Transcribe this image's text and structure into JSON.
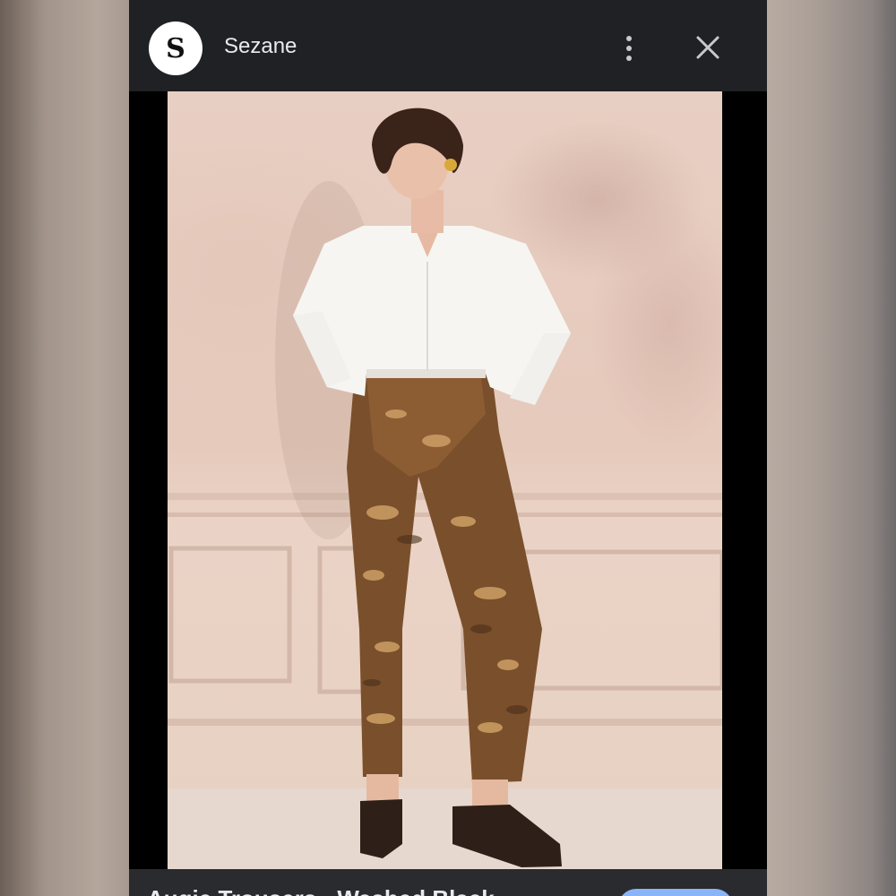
{
  "header": {
    "site_initial": "S",
    "site_name": "Sezane",
    "more_icon": "more-vert-icon",
    "close_icon": "close-icon"
  },
  "image": {
    "description_icon": "lens-search-icon"
  },
  "footer": {
    "partial_title": "Augie Trousers - Washed Black"
  },
  "colors": {
    "header_bg": "#202124",
    "accent": "#8ab4f8"
  }
}
